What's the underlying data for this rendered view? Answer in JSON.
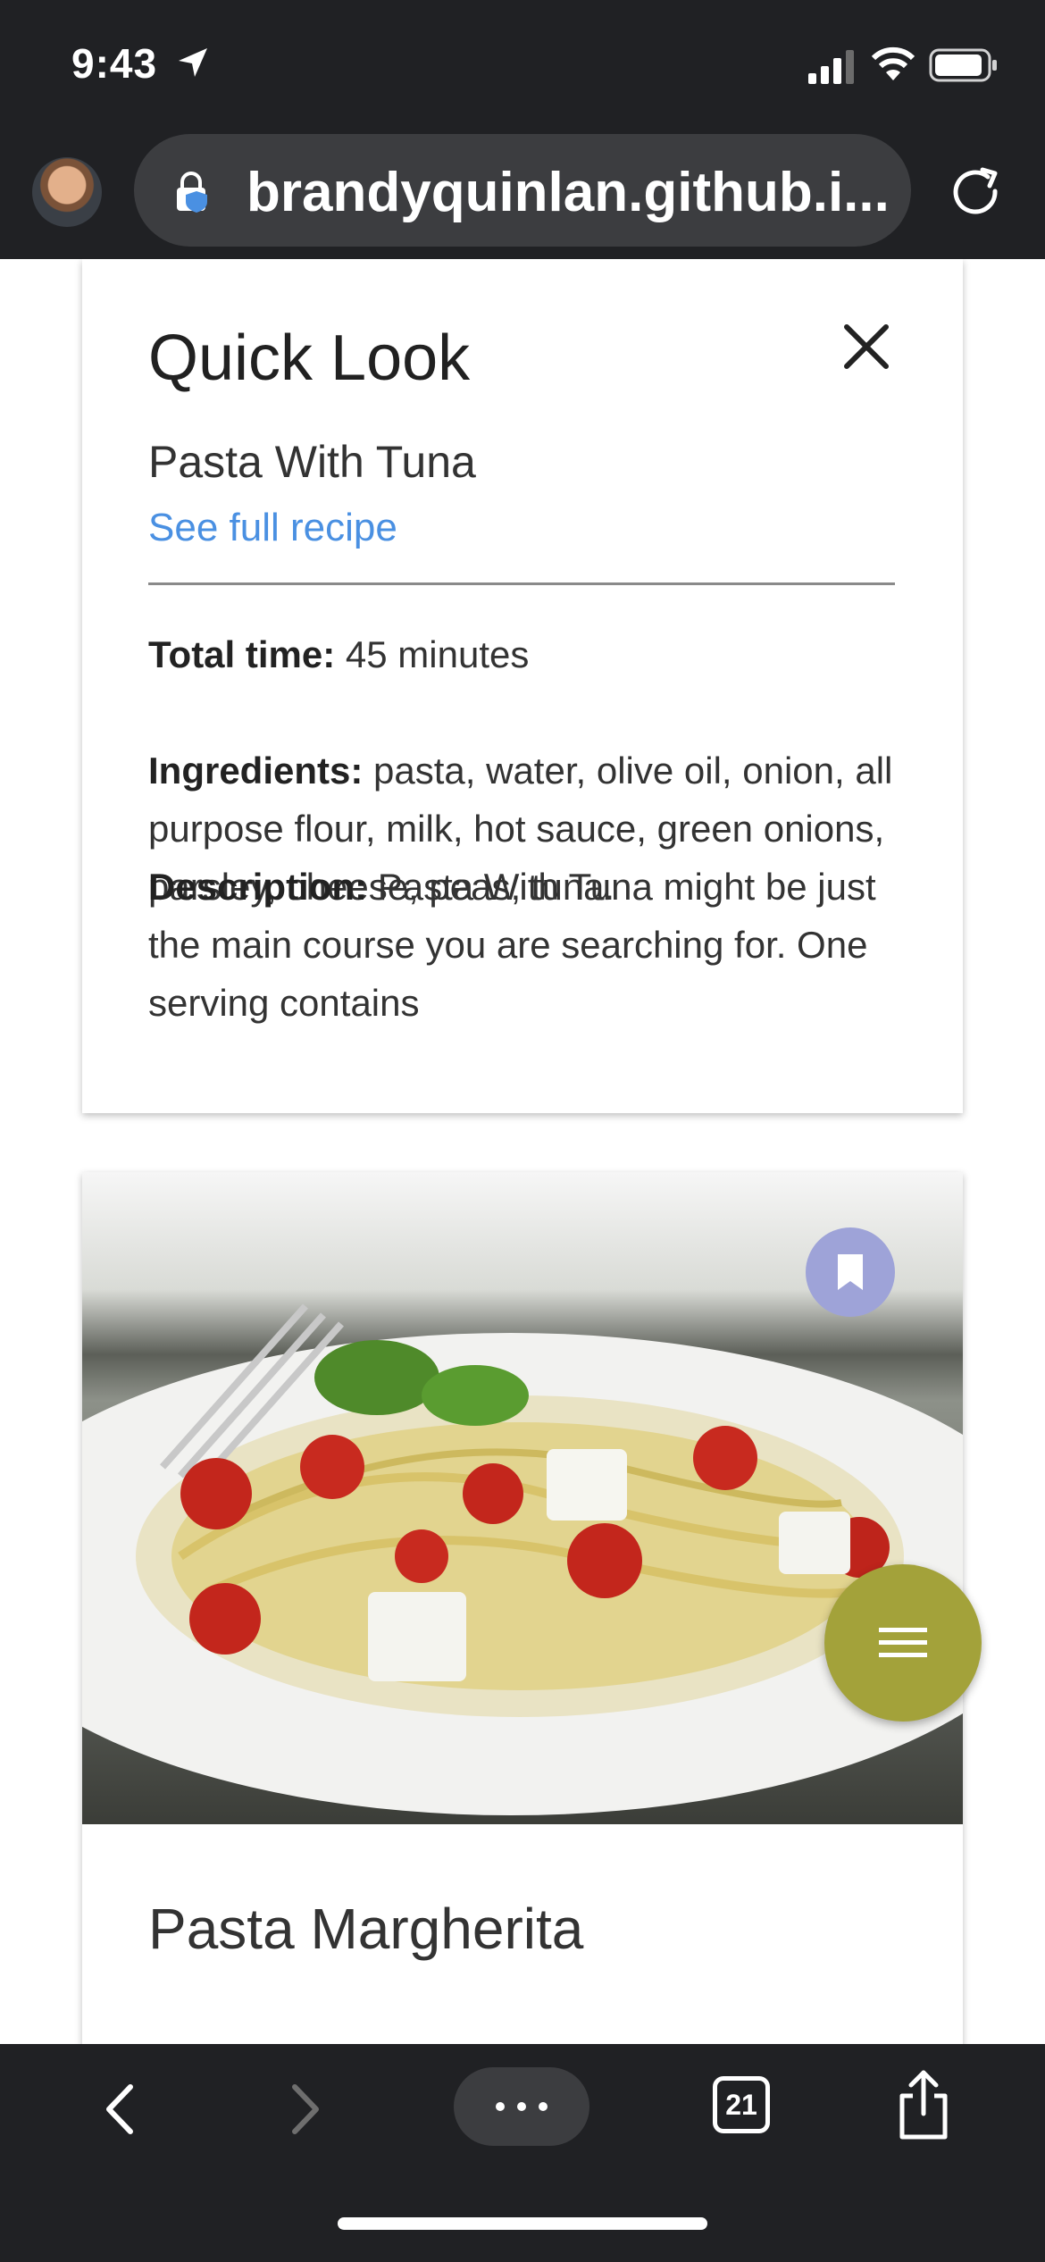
{
  "status_bar": {
    "time": "9:43"
  },
  "browser": {
    "url": "brandyquinlan.github.i...",
    "tab_count": "21"
  },
  "quick_look": {
    "title": "Quick Look",
    "recipe_name": "Pasta With Tuna",
    "link_text": "See full recipe",
    "total_time_label": "Total time:",
    "total_time_value": " 45 minutes",
    "ingredients_label": "Ingredients:",
    "ingredients_value": " pasta, water, olive oil, onion, all purpose flour, milk, hot sauce, green onions, parsley, cheese, peas, tuna.",
    "description_label": "Description:",
    "description_value": " Pasta With Tuna might be just the main course you are searching for. One serving contains "
  },
  "recipe_card": {
    "title": "Pasta Margherita"
  },
  "colors": {
    "accent_link": "#4a90e2",
    "fab": "#a3a23a",
    "bookmark": "#9ea3d8",
    "chrome_bg": "#202124"
  },
  "icons": [
    "location-icon",
    "signal-icon",
    "wifi-icon",
    "battery-icon",
    "lock-icon",
    "reload-icon",
    "close-icon",
    "bookmark-icon",
    "menu-icon",
    "back-icon",
    "forward-icon",
    "more-icon",
    "tabs-icon",
    "share-icon"
  ]
}
